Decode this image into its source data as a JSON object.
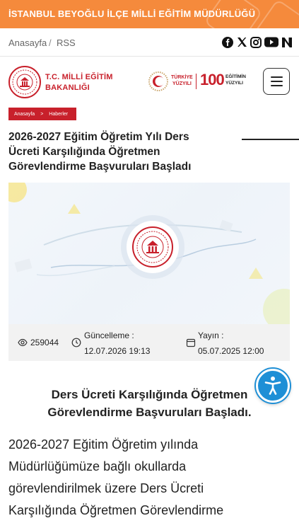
{
  "topbar": {
    "org_name": "İSTANBUL BEYOĞLU İLÇE MİLLİ EĞİTİM MÜDÜRLÜĞÜ"
  },
  "nav": {
    "breadcrumb": [
      "Anasayfa",
      "RSS"
    ],
    "separator": "/",
    "social_icons": [
      "facebook-icon",
      "x-icon",
      "instagram-icon",
      "youtube-icon",
      "nsosyal-icon"
    ]
  },
  "header": {
    "logo_text_line1": "T.C. MİLLİ EĞİTİM",
    "logo_text_line2": "BAKANLIĞI",
    "turkiye_label_1": "TÜRKİYE",
    "turkiye_label_2": "YÜZYILI",
    "yuzyil_number": "100",
    "yuzyil_label_1": "EĞİTİMİN",
    "yuzyil_label_2": "YÜZYILI"
  },
  "page_breadcrumb": {
    "home": "Anasayfa",
    "arrow": ">",
    "section": "Haberler"
  },
  "article": {
    "title_lines": [
      "2026-2027 Eğitim Öğretim Yılı Ders",
      "Ücreti Karşılığında Öğretmen",
      "Görevlendirme Başvuruları Başladı"
    ],
    "views": "259044",
    "updated_label": "Güncelleme :",
    "updated_value": "12.07.2026 19:13",
    "published_label": "Yayın :",
    "published_value": "05.07.2025 12:00",
    "subtitle_lines": [
      "Ders Ücreti Karşılığında Öğretmen",
      "Görevlendirme Başvuruları Başladı."
    ],
    "body_lines": [
      "2026-2027 Eğitim Öğretim yılında",
      "Müdürlüğümüze bağlı okullarda",
      "görevlendirilmek üzere Ders Ücreti",
      "Karşılığında Öğretmen Görevlendirme"
    ]
  },
  "colors": {
    "orange": "#f58a3c",
    "brand_red": "#c8202b",
    "a11y_blue": "#1e8fd6"
  }
}
